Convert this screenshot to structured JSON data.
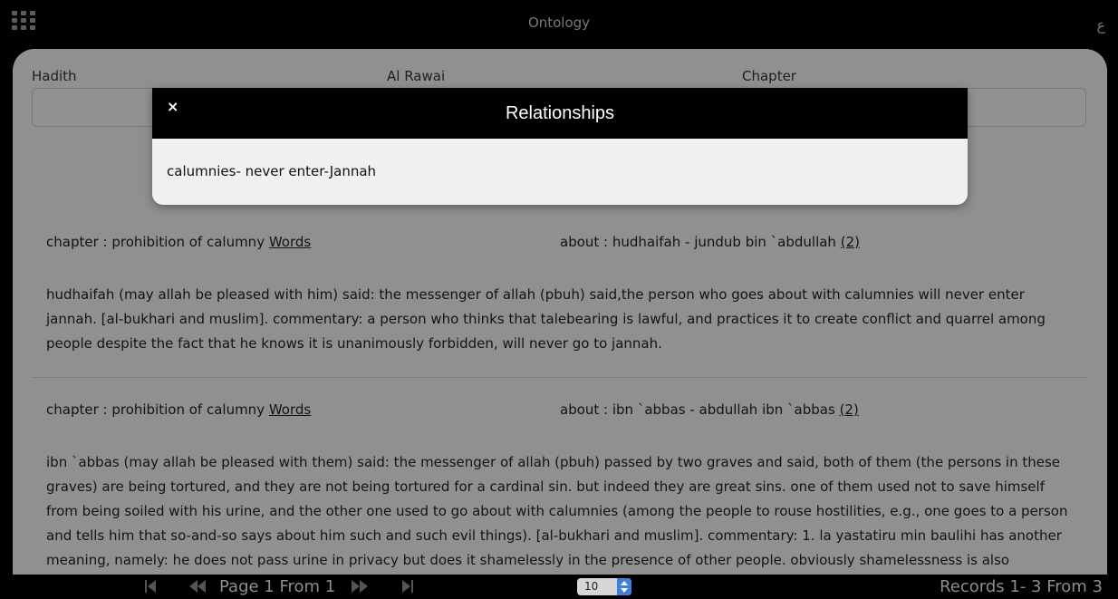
{
  "header": {
    "title": "Ontology",
    "lang_toggle": "ع"
  },
  "filters": {
    "hadith_label": "Hadith",
    "rawai_label": "Al Rawai",
    "chapter_label": "Chapter"
  },
  "records": [
    {
      "chapter": "chapter : prohibition of calumny",
      "words_link": "Words",
      "about": "about : hudhaifah - jundub bin `abdullah",
      "about_count": "(2)",
      "text": "hudhaifah (may allah be pleased with him) said: the messenger of allah (pbuh) said,the person who goes about with calumnies will never enter jannah. [al-bukhari and muslim]. commentary: a person who thinks that talebearing is lawful, and practices it to create conflict and quarrel among people despite the fact that he knows it is unanimously forbidden, will never go to jannah."
    },
    {
      "chapter": "chapter : prohibition of calumny",
      "words_link": "Words",
      "about": "about : ibn `abbas - abdullah ibn `abbas",
      "about_count": "(2)",
      "text": "ibn `abbas (may allah be pleased with them) said: the messenger of allah (pbuh) passed by two graves and said, both of them (the persons in these graves) are being tortured, and they are not being tortured for a cardinal sin. but indeed they are great sins. one of them used not to save himself from being soiled with his urine, and the other one used to go about with calumnies (among the people to rouse hostilities, e.g., one goes to a person and tells him that so-and-so says about him such and such evil things). [al-bukhari and muslim]. commentary: 1. la yastatiru min baulihi has another meaning, namely: he does not pass urine in privacy but does it shamelessly in the presence of other people. obviously shamelessness is also"
    }
  ],
  "modal": {
    "close": "×",
    "title": "Relationships",
    "content": "calumnies- never enter-Jannah"
  },
  "pager": {
    "page_label": "Page 1 From 1",
    "page_size": "10",
    "records_label": "Records 1- 3 From 3"
  }
}
